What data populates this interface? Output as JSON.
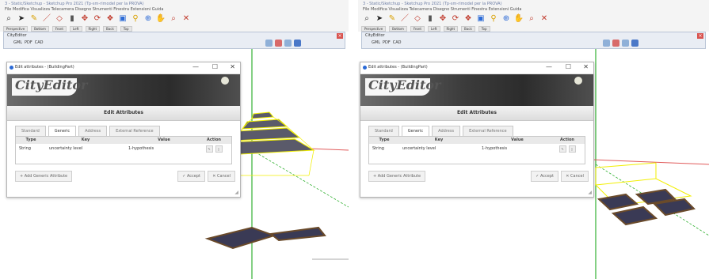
{
  "panels": [
    {
      "window_title": "3 - Static/Sketchup - Sketchup Pro 2021 (Tp-sm-rimodel per la PROVA)",
      "menu": "File  Modifica  Visualizza  Telecamera  Disegno  Strumenti  Finestra  Estensioni  Guida",
      "scene_tabs": [
        "Perspective",
        "Bottom",
        "Front",
        "Left",
        "Right",
        "Back",
        "Top"
      ],
      "plugin": {
        "title": "CityEditor",
        "close": "×",
        "toolbar": [
          "GML",
          "PDF",
          "CAD"
        ]
      },
      "dialog": {
        "title": "Edit attributes - (BuildingPart)",
        "minimize": "—",
        "maximize": "☐",
        "close": "✕",
        "logo": "CityEditor",
        "heading": "Edit Attributes",
        "tabs": [
          "Standard",
          "Generic",
          "Address",
          "External Reference"
        ],
        "columns": {
          "type": "Type",
          "key": "Key",
          "value": "Value",
          "action": "Action"
        },
        "row": {
          "type": "String",
          "key": "uncertainty level",
          "value": "1-hypothesis"
        },
        "add_button": "+ Add Generic Attribute",
        "accept_button": "✓ Accept",
        "cancel_button": "✕ Cancel"
      }
    },
    {
      "window_title": "3 - Static/Sketchup - Sketchup Pro 2021 (Tp-sm-rimodel per la PROVA)",
      "menu": "File  Modifica  Visualizza  Telecamera  Disegno  Strumenti  Finestra  Estensioni  Guida",
      "scene_tabs": [
        "Perspective",
        "Bottom",
        "Front",
        "Left",
        "Right",
        "Back",
        "Top"
      ],
      "plugin": {
        "title": "CityEditor",
        "close": "×",
        "toolbar": [
          "GML",
          "PDF",
          "CAD"
        ]
      },
      "dialog": {
        "title": "Edit attributes - (BuildingPart)",
        "minimize": "—",
        "maximize": "☐",
        "close": "✕",
        "logo": "CityEditor",
        "heading": "Edit Attributes",
        "tabs": [
          "Standard",
          "Generic",
          "Address",
          "External Reference"
        ],
        "columns": {
          "type": "Type",
          "key": "Key",
          "value": "Value",
          "action": "Action"
        },
        "row": {
          "type": "String",
          "key": "uncertainty level",
          "value": "1-hypothesis"
        },
        "add_button": "+ Add Generic Attribute",
        "accept_button": "✓ Accept",
        "cancel_button": "✕ Cancel"
      }
    }
  ],
  "toolbar_icons": [
    "search-icon",
    "select-arrow-icon",
    "pencil-icon",
    "line-icon",
    "shape-icon",
    "push-pull-icon",
    "move-icon",
    "rotate-icon",
    "scale-icon",
    "paint-bucket-icon",
    "tape-measure-icon",
    "orbit-icon",
    "pan-icon",
    "zoom-icon",
    "zoom-extents-icon"
  ],
  "colors": {
    "model_outline": "#f2ef00",
    "axis_green": "#32b132",
    "axis_red": "#e05a5a",
    "roof_dark": "#3a3a55",
    "base_brown": "#6a4a2a",
    "accent_blue": "#2b6ad6"
  }
}
